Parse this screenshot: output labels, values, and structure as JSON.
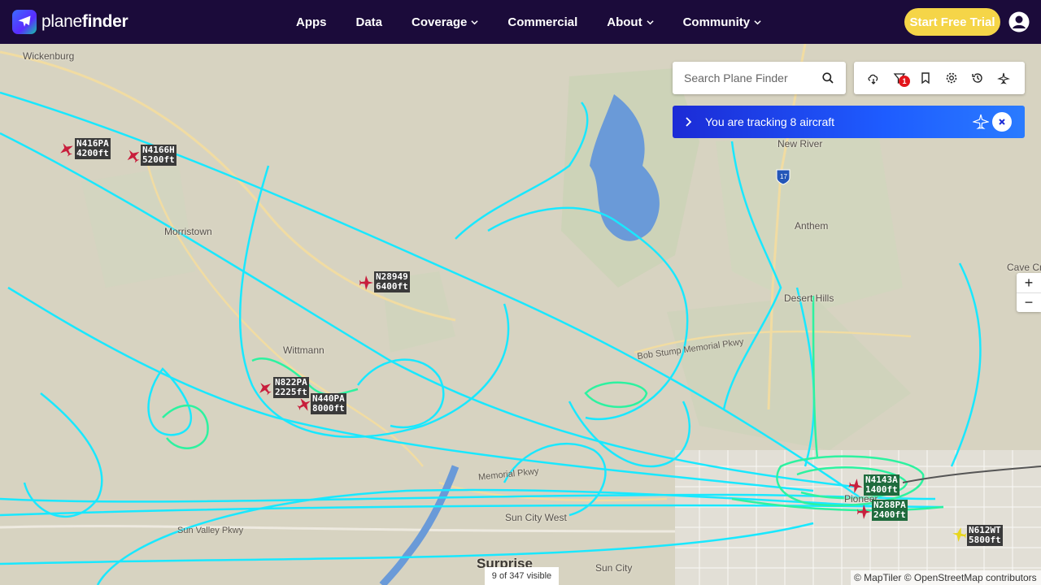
{
  "brand": {
    "name_plain": "plane",
    "name_bold": "finder"
  },
  "nav": {
    "items": [
      {
        "label": "Apps",
        "dropdown": false
      },
      {
        "label": "Data",
        "dropdown": false
      },
      {
        "label": "Coverage",
        "dropdown": true
      },
      {
        "label": "Commercial",
        "dropdown": false
      },
      {
        "label": "About",
        "dropdown": true
      },
      {
        "label": "Community",
        "dropdown": true
      }
    ],
    "cta_label": "Start Free Trial"
  },
  "search": {
    "placeholder": "Search Plane Finder",
    "icon": "search-icon"
  },
  "toolbar": {
    "icons": [
      "weather-icon",
      "filter-icon",
      "bookmark-icon",
      "gear-icon",
      "history-icon",
      "playback-icon"
    ],
    "filter_badge": "1"
  },
  "tracking": {
    "text": "You are tracking 8 aircraft"
  },
  "zoom": {
    "in": "+",
    "out": "−"
  },
  "map": {
    "places": {
      "wickenburg": "Wickenburg",
      "morristown": "Morristown",
      "wittmann": "Wittmann",
      "new_river": "New River",
      "anthem": "Anthem",
      "desert_hills": "Desert Hills",
      "cave_creek": "Cave Cre",
      "surprise": "Surprise",
      "sun_city": "Sun City",
      "sun_city_west": "Sun City West",
      "pioneer": "Pioneer"
    },
    "roads": {
      "bobstump": "Bob Stump Memorial Pkwy",
      "sunvalley": "Sun Valley Pkwy",
      "memorial": "Memorial Pkwy",
      "i17": "17"
    }
  },
  "aircraft": [
    {
      "callsign": "N416PA",
      "altitude": "4200ft",
      "selected": false
    },
    {
      "callsign": "N4166H",
      "altitude": "5200ft",
      "selected": false
    },
    {
      "callsign": "N28949",
      "altitude": "6400ft",
      "selected": false
    },
    {
      "callsign": "N822PA",
      "altitude": "2225ft",
      "selected": false
    },
    {
      "callsign": "N440PA",
      "altitude": "8000ft",
      "selected": false
    },
    {
      "callsign": "N4143A",
      "altitude": "1400ft",
      "selected": true
    },
    {
      "callsign": "N288PA",
      "altitude": "2400ft",
      "selected": true
    },
    {
      "callsign": "N612WT",
      "altitude": "5800ft",
      "selected": false
    }
  ],
  "colors": {
    "track": "#19e8ff",
    "track_low": "#2df2a0",
    "aircraft": "#c81e3c",
    "aircraft_other": "#e8d61c",
    "navbar": "#1b0b3a",
    "cta": "#f5d548"
  },
  "status": {
    "visible": "9 of 347 visible"
  },
  "attribution": "© MapTiler © OpenStreetMap contributors"
}
